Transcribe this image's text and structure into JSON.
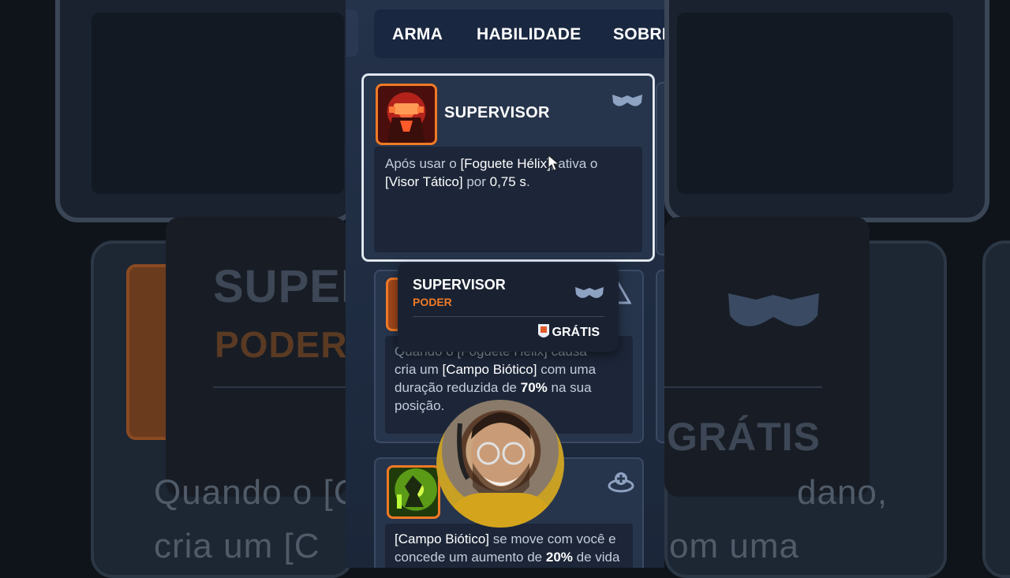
{
  "tabs": [
    {
      "label": "ARMA"
    },
    {
      "label": "HABILIDADE"
    },
    {
      "label": "SOBRI"
    }
  ],
  "cards": [
    {
      "title": "SUPERVISOR",
      "desc_parts": [
        "Após usar o ",
        "[Foguete Hélix]",
        ", ativa o ",
        "[Visor Tático]",
        " por ",
        "0,75 s",
        "."
      ]
    },
    {
      "desc_partial_1": "Quando o [Foguete Hélix] causa dano,",
      "desc_parts": [
        "cria um ",
        "[Campo Biótico]",
        " com uma duração reduzida de ",
        "70%",
        " na sua posição."
      ]
    },
    {
      "desc_parts": [
        "[Campo Biótico]",
        " se move com você e concede um aumento de ",
        "20%",
        " de vida"
      ]
    }
  ],
  "tooltip": {
    "title": "SUPERVISOR",
    "subtitle": "PODER",
    "price": "GRÁTIS"
  },
  "background": {
    "left_title": "SUPER",
    "left_sub": "PODER",
    "left_text_1": "Quando o [C",
    "left_text_2": "cria um [C",
    "right_price": "GRÁTIS",
    "right_text_1": "dano,",
    "right_text_2": "om uma"
  },
  "colors": {
    "accent_orange": "#f07a26",
    "panel_bg": "#24324a",
    "card_bg": "#27354c"
  },
  "icons": {
    "visor": "goggles-icon",
    "biotic": "biotic-field-icon",
    "coin": "currency-icon"
  }
}
